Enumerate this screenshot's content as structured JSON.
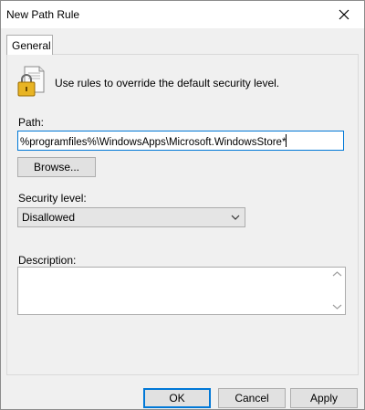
{
  "window": {
    "title": "New Path Rule"
  },
  "tabs": [
    {
      "label": "General"
    }
  ],
  "intro": {
    "text": "Use rules to override the default security level."
  },
  "path": {
    "label": "Path:",
    "value": "%programfiles%\\WindowsApps\\Microsoft.WindowsStore*"
  },
  "browse": {
    "label": "Browse..."
  },
  "security": {
    "label": "Security level:",
    "selected": "Disallowed"
  },
  "description": {
    "label": "Description:",
    "value": ""
  },
  "buttons": {
    "ok": "OK",
    "cancel": "Cancel",
    "apply": "Apply"
  },
  "icons": {
    "close": "close-icon",
    "rule": "lock-document-icon",
    "dropdown": "chevron-down-icon",
    "scroll_up": "scroll-up-icon",
    "scroll_down": "scroll-down-icon"
  },
  "colors": {
    "focus": "#0078d7",
    "panel": "#f0f0f0",
    "button": "#e1e1e1"
  }
}
